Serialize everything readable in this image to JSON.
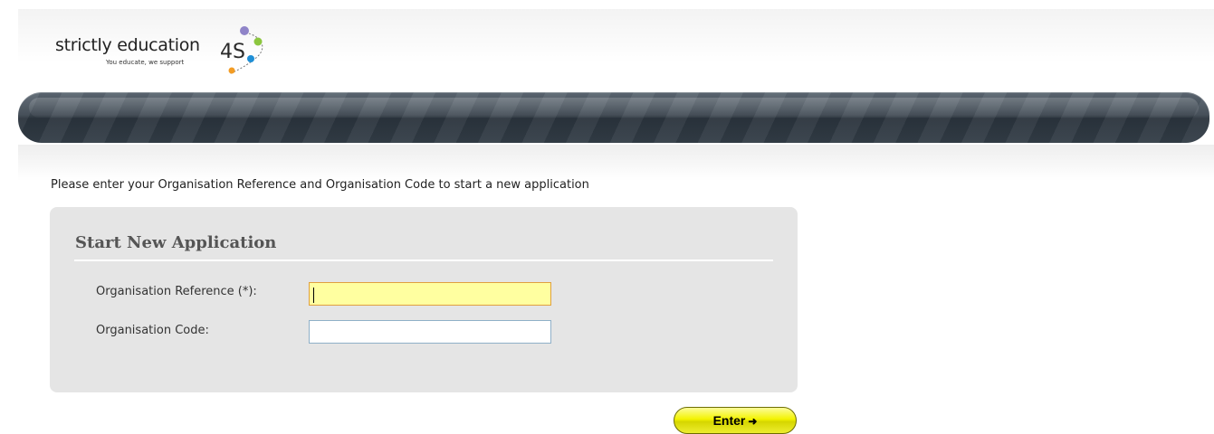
{
  "logo": {
    "name": "strictly education",
    "mark": "4S",
    "tagline": "You educate, we support"
  },
  "instruction": "Please enter your Organisation Reference and Organisation Code to start a new application",
  "form": {
    "title": "Start New Application",
    "fields": [
      {
        "label": "Organisation Reference (*):",
        "value": "",
        "placeholder": ""
      },
      {
        "label": "Organisation Code:",
        "value": "",
        "placeholder": ""
      }
    ],
    "submit_label": "Enter",
    "submit_icon": "right-arrow-icon"
  },
  "colors": {
    "focused_field": "#ffffa0",
    "button": "#f3f300",
    "navbar": "#3c4650",
    "panel": "#e5e5e5"
  }
}
